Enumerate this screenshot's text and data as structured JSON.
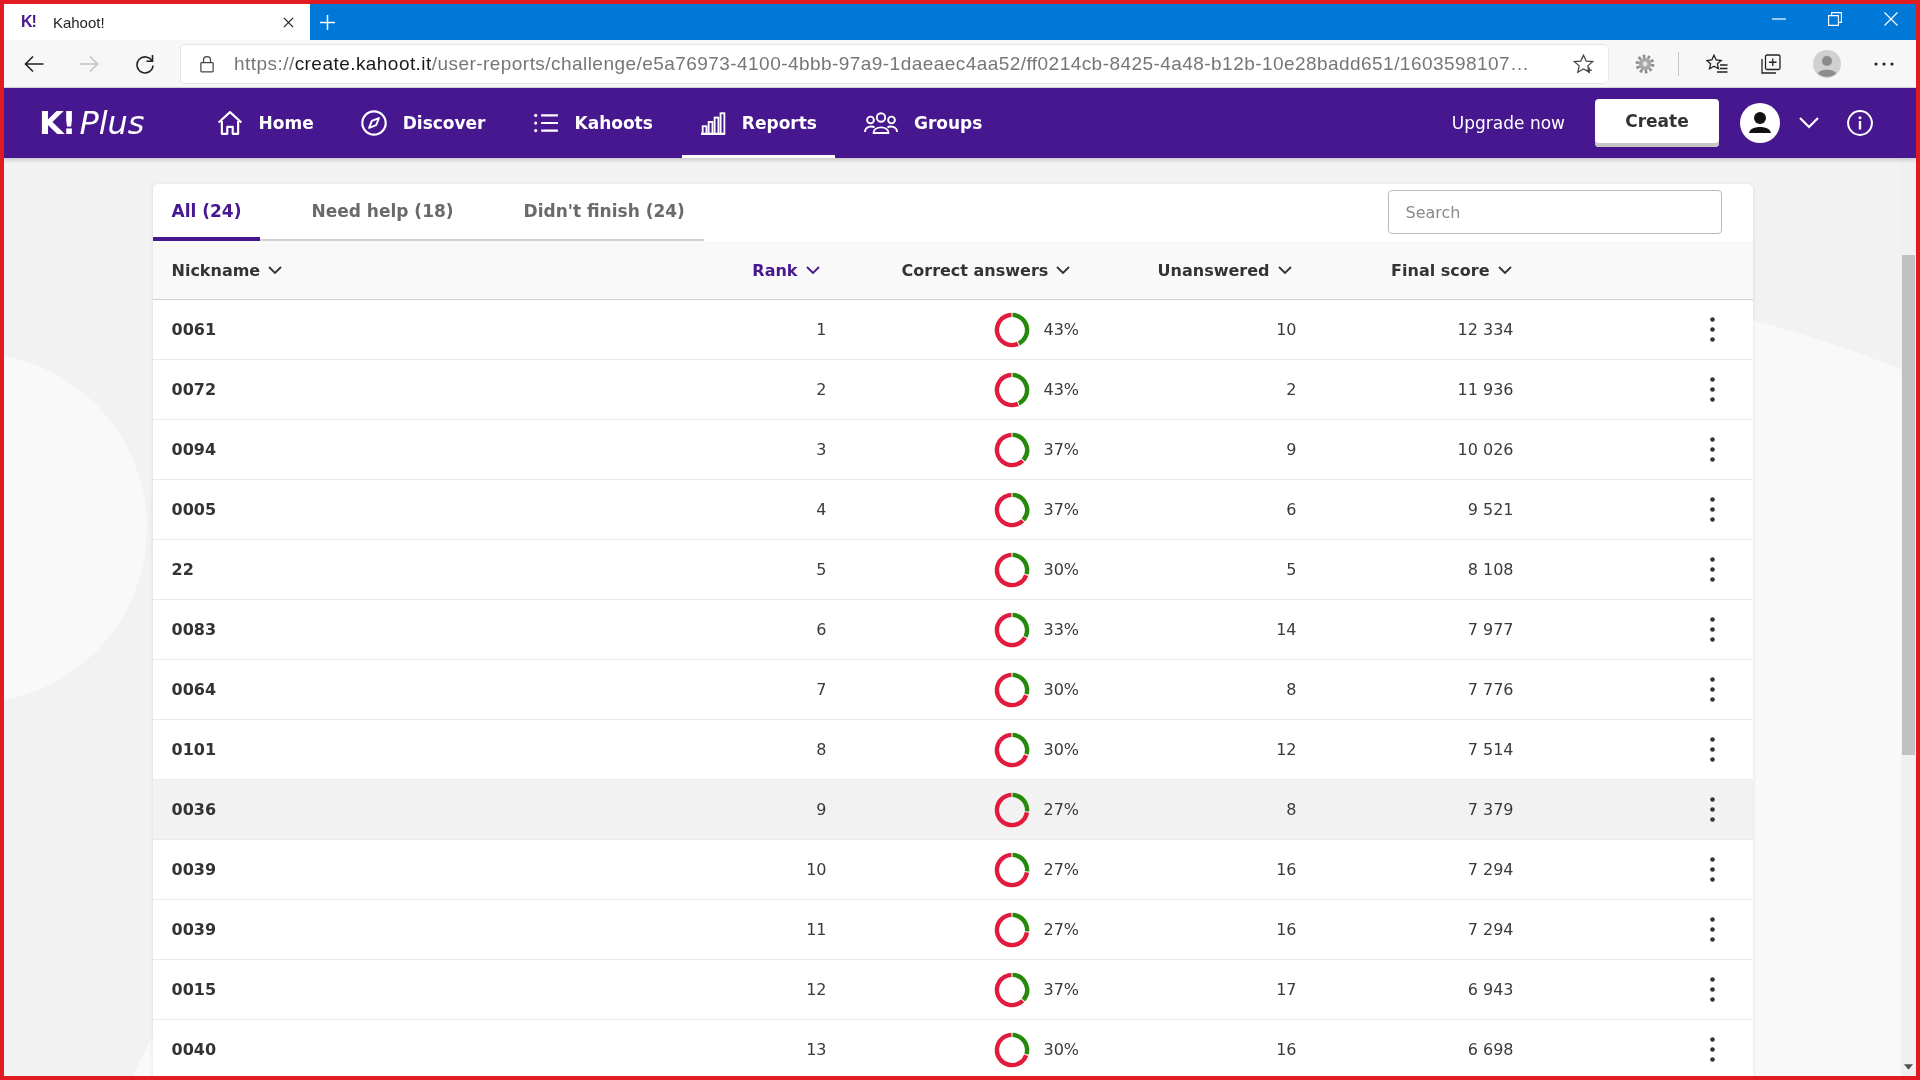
{
  "browser": {
    "tab": {
      "favicon": "K!",
      "title": "Kahoot!"
    },
    "forward_disabled": true,
    "url": {
      "scheme": "https://",
      "host": "create.kahoot.it",
      "path": "/user-reports/challenge/e5a76973-4100-4bbb-97a9-1daeaec4aa52/ff0214cb-8425-4a48-b12b-10e28badd651/1603598107…"
    }
  },
  "nav": {
    "logo": {
      "mark": "K!",
      "tier": "Plus"
    },
    "items": [
      {
        "label": "Home",
        "selected": false
      },
      {
        "label": "Discover",
        "selected": false
      },
      {
        "label": "Kahoots",
        "selected": false
      },
      {
        "label": "Reports",
        "selected": true
      },
      {
        "label": "Groups",
        "selected": false
      }
    ],
    "upgrade_link": "Upgrade now",
    "create_button": "Create"
  },
  "tabs": [
    {
      "label": "All (24)",
      "selected": true
    },
    {
      "label": "Need help (18)",
      "selected": false
    },
    {
      "label": "Didn't finish (24)",
      "selected": false
    }
  ],
  "search": {
    "placeholder": "Search"
  },
  "columns": [
    {
      "label": "Nickname",
      "sorted": false
    },
    {
      "label": "Rank",
      "sorted": true
    },
    {
      "label": "Correct answers",
      "sorted": false
    },
    {
      "label": "Unanswered",
      "sorted": false
    },
    {
      "label": "Final score",
      "sorted": false
    }
  ],
  "rows": [
    {
      "nickname": "0061",
      "rank": "1",
      "correct": "43%",
      "chart_data": {
        "type": "donut",
        "values": [
          43,
          57
        ]
      },
      "unanswered": "10",
      "final_score": "12 334",
      "hovered": false
    },
    {
      "nickname": "0072",
      "rank": "2",
      "correct": "43%",
      "chart_data": {
        "type": "donut",
        "values": [
          43,
          57
        ]
      },
      "unanswered": "2",
      "final_score": "11 936",
      "hovered": false
    },
    {
      "nickname": "0094",
      "rank": "3",
      "correct": "37%",
      "chart_data": {
        "type": "donut",
        "values": [
          37,
          63
        ]
      },
      "unanswered": "9",
      "final_score": "10 026",
      "hovered": false
    },
    {
      "nickname": "0005",
      "rank": "4",
      "correct": "37%",
      "chart_data": {
        "type": "donut",
        "values": [
          37,
          63
        ]
      },
      "unanswered": "6",
      "final_score": "9 521",
      "hovered": false
    },
    {
      "nickname": "22",
      "rank": "5",
      "correct": "30%",
      "chart_data": {
        "type": "donut",
        "values": [
          30,
          70
        ]
      },
      "unanswered": "5",
      "final_score": "8 108",
      "hovered": false
    },
    {
      "nickname": "0083",
      "rank": "6",
      "correct": "33%",
      "chart_data": {
        "type": "donut",
        "values": [
          33,
          67
        ]
      },
      "unanswered": "14",
      "final_score": "7 977",
      "hovered": false
    },
    {
      "nickname": "0064",
      "rank": "7",
      "correct": "30%",
      "chart_data": {
        "type": "donut",
        "values": [
          30,
          70
        ]
      },
      "unanswered": "8",
      "final_score": "7 776",
      "hovered": false
    },
    {
      "nickname": "0101",
      "rank": "8",
      "correct": "30%",
      "chart_data": {
        "type": "donut",
        "values": [
          30,
          70
        ]
      },
      "unanswered": "12",
      "final_score": "7 514",
      "hovered": false
    },
    {
      "nickname": "0036",
      "rank": "9",
      "correct": "27%",
      "chart_data": {
        "type": "donut",
        "values": [
          27,
          73
        ]
      },
      "unanswered": "8",
      "final_score": "7 379",
      "hovered": true
    },
    {
      "nickname": "0039",
      "rank": "10",
      "correct": "27%",
      "chart_data": {
        "type": "donut",
        "values": [
          27,
          73
        ]
      },
      "unanswered": "16",
      "final_score": "7 294",
      "hovered": false
    },
    {
      "nickname": "0039",
      "rank": "11",
      "correct": "27%",
      "chart_data": {
        "type": "donut",
        "values": [
          27,
          73
        ]
      },
      "unanswered": "16",
      "final_score": "7 294",
      "hovered": false
    },
    {
      "nickname": "0015",
      "rank": "12",
      "correct": "37%",
      "chart_data": {
        "type": "donut",
        "values": [
          37,
          63
        ]
      },
      "unanswered": "17",
      "final_score": "6 943",
      "hovered": false
    },
    {
      "nickname": "0040",
      "rank": "13",
      "correct": "30%",
      "chart_data": {
        "type": "donut",
        "values": [
          30,
          70
        ]
      },
      "unanswered": "16",
      "final_score": "6 698",
      "hovered": false
    }
  ]
}
